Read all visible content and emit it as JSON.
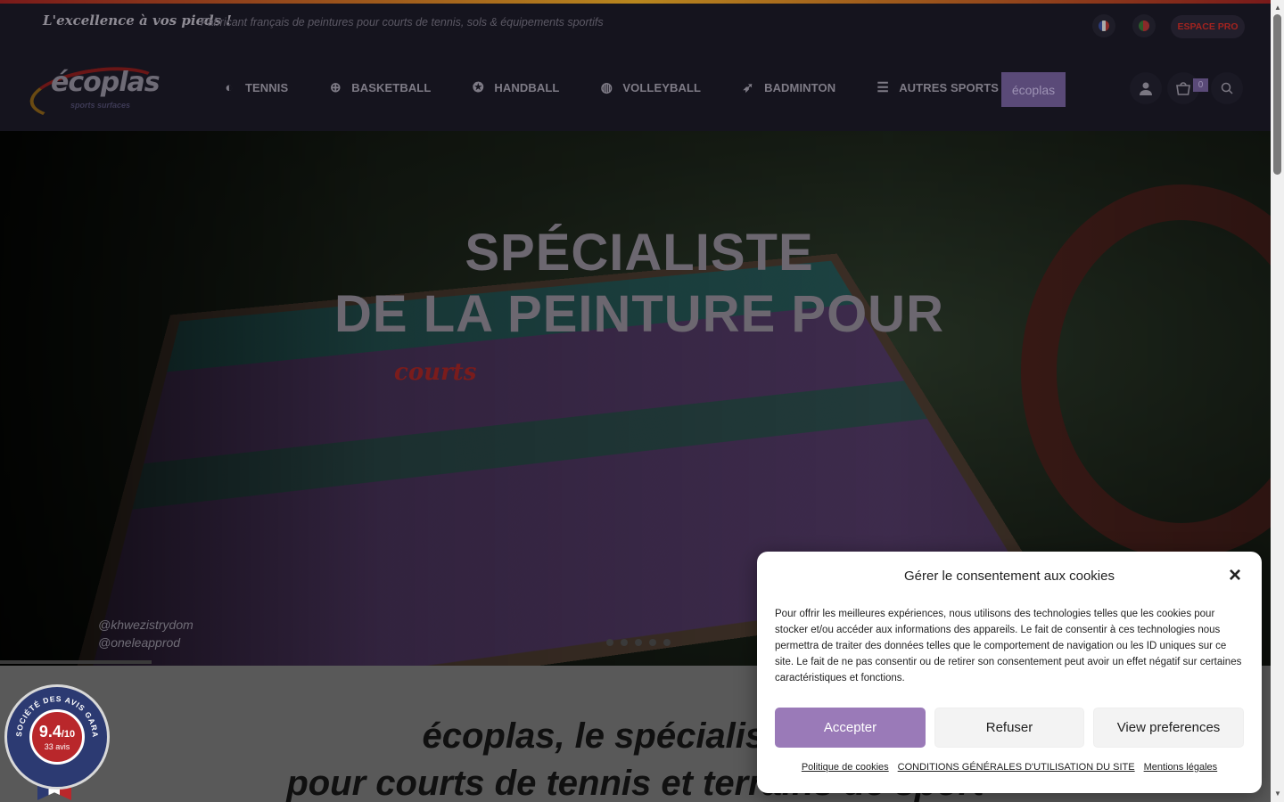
{
  "topbar": {
    "tagline": "L'excellence à vos pieds !",
    "subtagline": "Fabricant français de peintures pour courts de tennis, sols & équipements sportifs",
    "espace_pro": "ESPACE PRO"
  },
  "logo": {
    "name": "écoplas",
    "sub": "sports surfaces"
  },
  "nav": {
    "items": [
      {
        "label": "TENNIS",
        "icon": "tennis-ball-icon"
      },
      {
        "label": "BASKETBALL",
        "icon": "basketball-icon"
      },
      {
        "label": "HANDBALL",
        "icon": "handball-icon"
      },
      {
        "label": "VOLLEYBALL",
        "icon": "volleyball-icon"
      },
      {
        "label": "BADMINTON",
        "icon": "shuttlecock-icon"
      },
      {
        "label": "AUTRES SPORTS",
        "icon": "menu-lines-icon"
      }
    ],
    "brand_button": "écoplas",
    "cart_count": "0"
  },
  "hero": {
    "title_line1": "SPÉCIALISTE",
    "title_line2": "DE LA PEINTURE POUR",
    "script_word": "courts",
    "credit1": "@khwezistrydom",
    "credit2": "@oneleapprod"
  },
  "content": {
    "heading_line1": "écoplas, le spécialiste de",
    "heading_line2": "pour courts de tennis et terrains de sport"
  },
  "badge": {
    "score": "9.4",
    "scale": "/10",
    "count": "33 avis",
    "org": "SOCIÉTÉ DES AVIS GARANTIS"
  },
  "cookie": {
    "title": "Gérer le consentement aux cookies",
    "body": "Pour offrir les meilleures expériences, nous utilisons des technologies telles que les cookies pour stocker et/ou accéder aux informations des appareils. Le fait de consentir à ces technologies nous permettra de traiter des données telles que le comportement de navigation ou les ID uniques sur ce site. Le fait de ne pas consentir ou de retirer son consentement peut avoir un effet négatif sur certaines caractéristiques et fonctions.",
    "accept": "Accepter",
    "refuse": "Refuser",
    "preferences": "View preferences",
    "link_policy": "Politique de cookies",
    "link_cgu": "CONDITIONS GÉNÉRALES D'UTILISATION DU SITE",
    "link_legal": "Mentions légales"
  },
  "colors": {
    "accent_purple": "#9a7ab8",
    "espace_pro_red": "#a2231f",
    "header_bg": "#15141e"
  }
}
